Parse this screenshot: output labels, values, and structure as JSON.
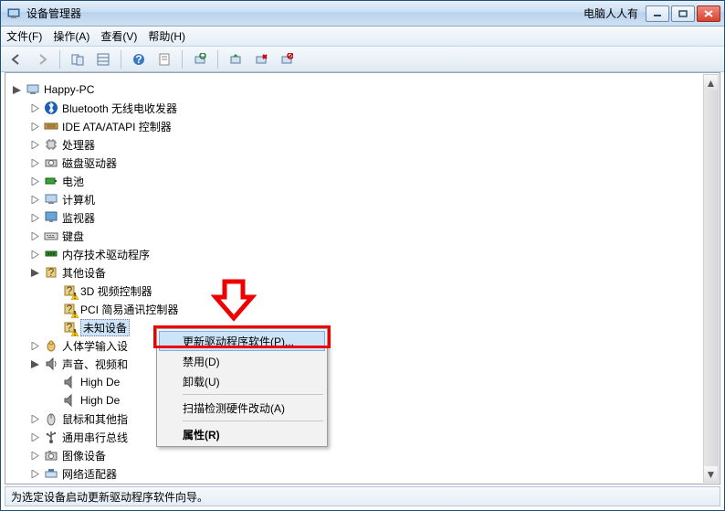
{
  "title": "设备管理器",
  "brand": "电脑人人有",
  "menus": {
    "file": "文件(F)",
    "action": "操作(A)",
    "view": "查看(V)",
    "help": "帮助(H)"
  },
  "root": "Happy-PC",
  "nodes": {
    "bluetooth": "Bluetooth 无线电收发器",
    "ide": "IDE ATA/ATAPI 控制器",
    "cpu": "处理器",
    "disk": "磁盘驱动器",
    "battery": "电池",
    "computer": "计算机",
    "monitor": "监视器",
    "keyboard": "键盘",
    "memtech": "内存技术驱动程序",
    "other": "其他设备",
    "other_3d": "3D 视频控制器",
    "other_pci": "PCI 简易通讯控制器",
    "other_unknown": "未知设备",
    "hid": "人体学输入设",
    "audio": "声音、视频和",
    "audio_hd1": "High De",
    "audio_hd2": "High De",
    "mouse": "鼠标和其他指",
    "usb": "通用串行总线",
    "image": "图像设备",
    "network": "网络适配器"
  },
  "context": {
    "update": "更新驱动程序软件(P)...",
    "disable": "禁用(D)",
    "uninstall": "卸载(U)",
    "scan": "扫描检测硬件改动(A)",
    "properties": "属性(R)"
  },
  "status": "为选定设备启动更新驱动程序软件向导。"
}
